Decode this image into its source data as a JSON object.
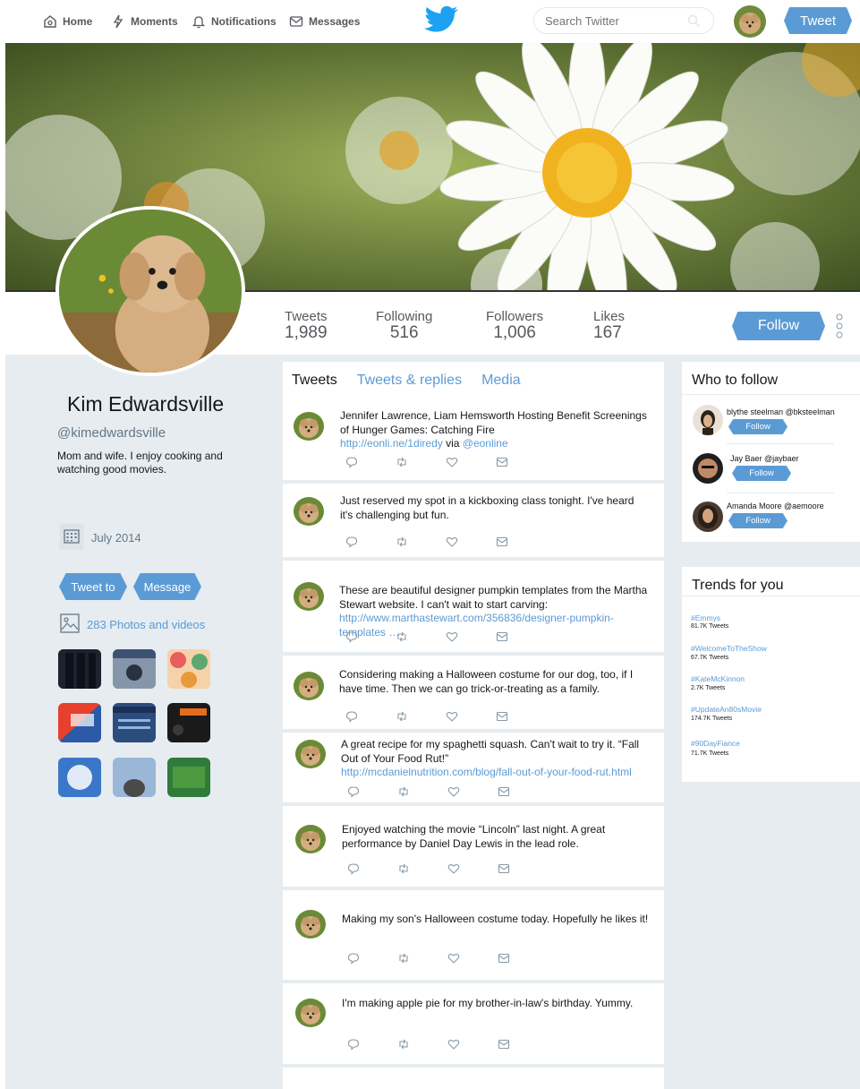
{
  "nav": {
    "home": "Home",
    "moments": "Moments",
    "notifications": "Notifications",
    "messages": "Messages",
    "search_placeholder": "Search Twitter",
    "tweet_button": "Tweet"
  },
  "profile": {
    "name": "Kim Edwardsville",
    "handle": "@kimedwardsville",
    "bio": "Mom and wife. I enjoy cooking and watching good movies.",
    "joined": "July 2014",
    "tweet_to": "Tweet to",
    "message": "Message",
    "photos": "283 Photos and videos"
  },
  "stats": {
    "tweets_label": "Tweets",
    "tweets_value": "1,989",
    "following_label": "Following",
    "following_value": "516",
    "followers_label": "Followers",
    "followers_value": "1,006",
    "likes_label": "Likes",
    "likes_value": "167",
    "follow_button": "Follow"
  },
  "tabs": [
    "Tweets",
    "Tweets & replies",
    "Media"
  ],
  "tweets": [
    {
      "text": "Jennifer Lawrence, Liam Hemsworth Hosting Benefit Screenings of Hunger Games: Catching Fire",
      "link": "http://eonli.ne/1diredy",
      "via": " via ",
      "mention": "@eonline"
    },
    {
      "text": "Just reserved my spot in a kickboxing class tonight. I've heard it's challenging but fun."
    },
    {
      "text": "These are beautiful designer pumpkin templates from the Martha Stewart website. I can't wait to start carving: ",
      "link": "http://www.marthastewart.com/356836/designer-pumpkin-templates …"
    },
    {
      "text": "Considering making a Halloween costume for our dog, too, if I have time. Then we can go trick-or-treating as a family."
    },
    {
      "text": "A great recipe for my spaghetti squash. Can't wait to try it. “Fall Out of Your Food Rut!”",
      "link": "http://mcdanielnutrition.com/blog/fall-out-of-your-food-rut.html"
    },
    {
      "text": "Enjoyed watching the movie “Lincoln” last night. A great performance by Daniel Day Lewis in the lead role."
    },
    {
      "text": "Making my son's Halloween costume today. Hopefully he likes it!"
    },
    {
      "text": "I'm making apple pie for my brother-in-law's birthday. Yummy."
    }
  ],
  "who_to_follow": {
    "title": "Who to follow",
    "follow_label": "Follow",
    "people": [
      {
        "name": "blythe steelman @bksteelman"
      },
      {
        "name": "Jay Baer @jaybaer"
      },
      {
        "name": "Amanda Moore @aemoore"
      }
    ]
  },
  "trends": {
    "title": "Trends for you",
    "items": [
      {
        "tag": "#Emmys",
        "count": "81.7K Tweets"
      },
      {
        "tag": "#WelcomeToTheShow",
        "count": "67.7K Tweets"
      },
      {
        "tag": "#KateMcKinnon",
        "count": "2.7K Tweets"
      },
      {
        "tag": "#UpdateAn80sMovie",
        "count": "174.7K Tweets"
      },
      {
        "tag": "#90DayFiance",
        "count": "71.7K Tweets"
      }
    ]
  },
  "colors": {
    "accent": "#5b9bd5",
    "background": "#e6ecf0"
  },
  "photo_thumbs": [
    "jeans-thumb",
    "at-univ-thumb",
    "pattern-thumb",
    "divers-thumb",
    "plant-feed-thumb",
    "halloween-wolf-thumb",
    "finals-thumb",
    "groundhog-thumb",
    "st-patricks-thumb"
  ]
}
